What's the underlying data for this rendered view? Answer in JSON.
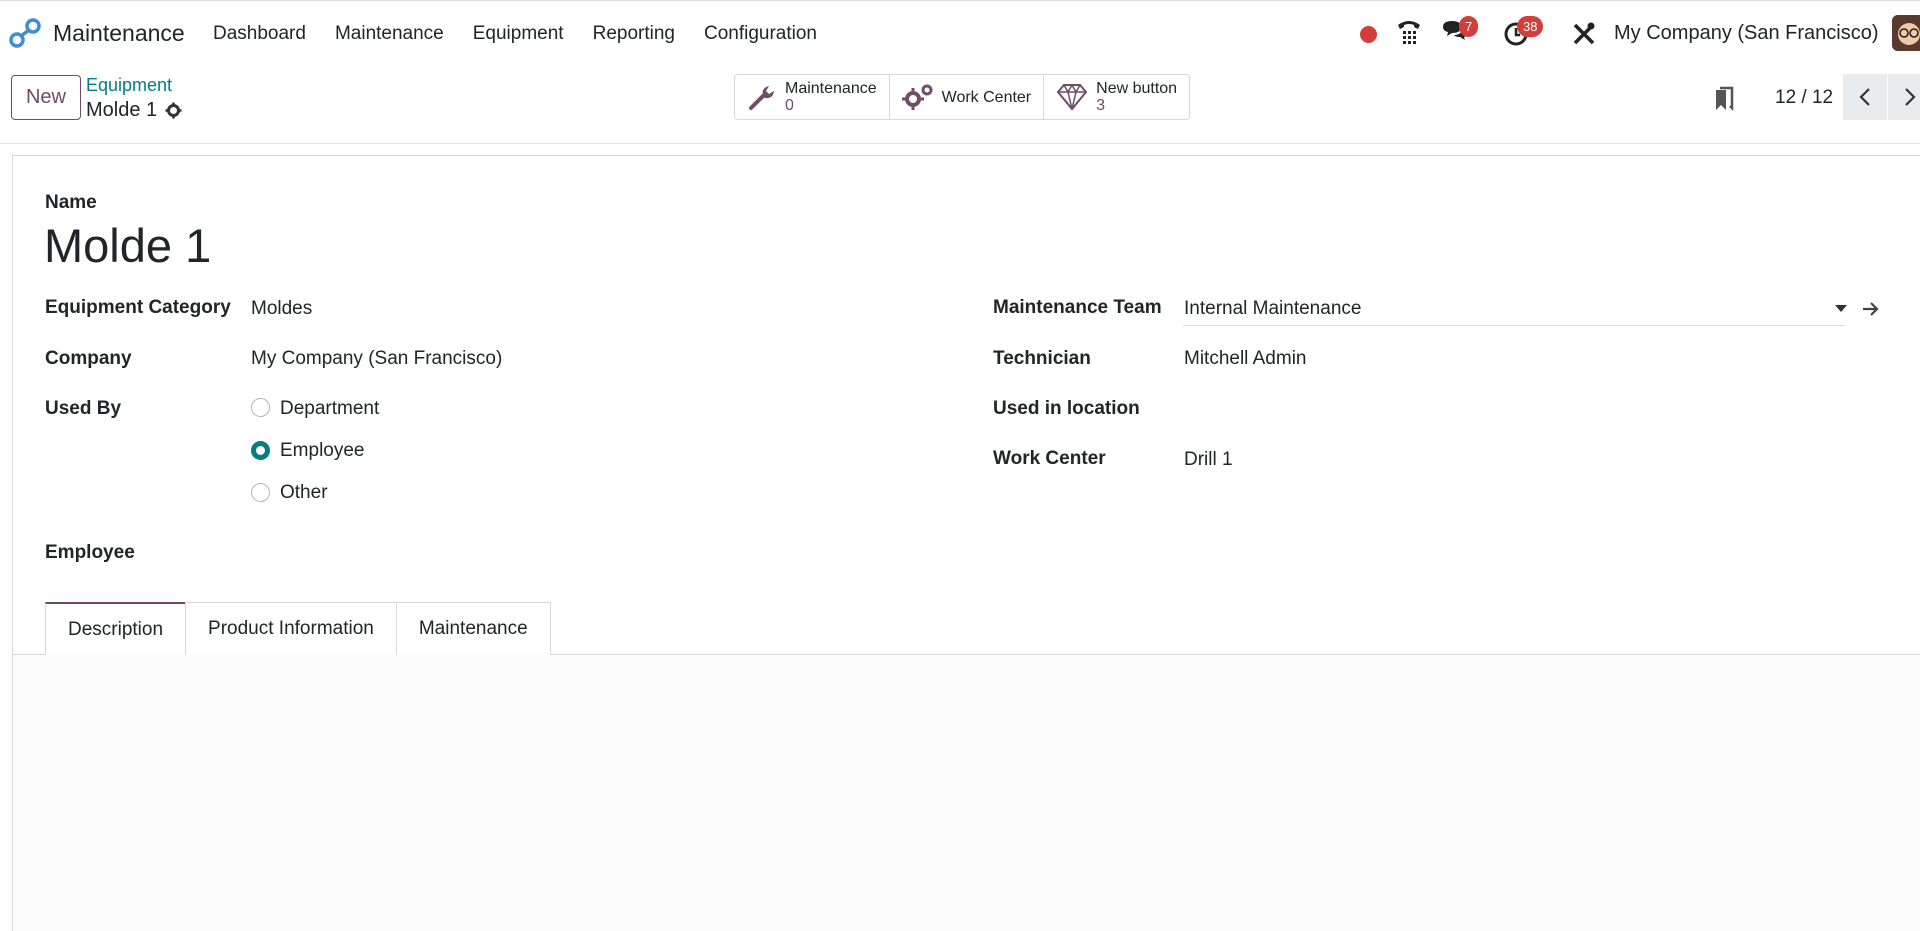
{
  "app": {
    "name": "Maintenance",
    "menu": [
      "Dashboard",
      "Maintenance",
      "Equipment",
      "Reporting",
      "Configuration"
    ]
  },
  "systray": {
    "messages_count": "7",
    "activities_count": "38",
    "company": "My Company (San Francisco)"
  },
  "control": {
    "new_label": "New",
    "breadcrumb_parent": "Equipment",
    "breadcrumb_current": "Molde 1",
    "stats": [
      {
        "label": "Maintenance",
        "value": "0"
      },
      {
        "label": "Work Center",
        "value": ""
      },
      {
        "label": "New button",
        "value": "3"
      }
    ],
    "pager": "12 / 12"
  },
  "form": {
    "name_label": "Name",
    "name_value": "Molde 1",
    "left": {
      "category_label": "Equipment Category",
      "category_value": "Moldes",
      "company_label": "Company",
      "company_value": "My Company (San Francisco)",
      "used_by_label": "Used By",
      "used_by_options": [
        "Department",
        "Employee",
        "Other"
      ],
      "used_by_selected": "Employee",
      "employee_label": "Employee"
    },
    "right": {
      "team_label": "Maintenance Team",
      "team_value": "Internal Maintenance",
      "technician_label": "Technician",
      "technician_value": "Mitchell Admin",
      "location_label": "Used in location",
      "workcenter_label": "Work Center",
      "workcenter_value": "Drill 1"
    }
  },
  "tabs": [
    "Description",
    "Product Information",
    "Maintenance"
  ],
  "colors": {
    "brand": "#714b67",
    "accent": "#017e84",
    "badge": "#d23f3a"
  }
}
